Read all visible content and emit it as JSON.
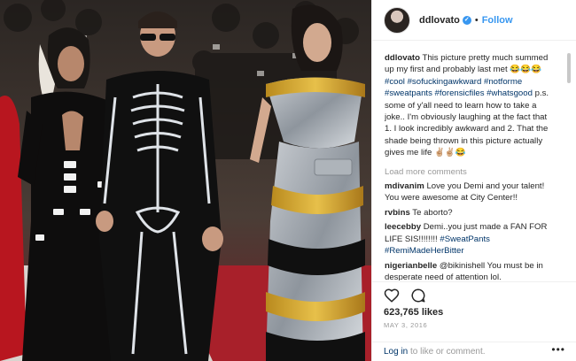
{
  "header": {
    "username": "ddlovato",
    "verified_mark": "✓",
    "separator": "•",
    "follow_label": "Follow"
  },
  "caption": {
    "username": "ddlovato",
    "text1": "This picture pretty much summed up my first and probably last met 😂😂😂",
    "tags1": "#cool #sofuckingawkward #notforme #sweatpants #forensicfiles #whatsgood",
    "text2": "p.s. some of y'all need to learn how to take a joke.. I'm obviously laughing at the fact that 1. I look incredibly awkward and 2. That the shade being thrown in this picture actually gives me life ✌🏼✌🏼😂"
  },
  "load_more": "Load more comments",
  "comments": [
    {
      "user": "mdivanim",
      "text": "Love you Demi and your talent! You were awesome at City Center!!",
      "tags": ""
    },
    {
      "user": "rvbins",
      "text": "Te aborto?",
      "tags": ""
    },
    {
      "user": "leecebby",
      "text": "Demi..you just made a FAN FOR LIFE SIS!!!!!!!!",
      "tags": "#SweatPants #RemiMadeHerBitter"
    },
    {
      "user": "nigerianbelle",
      "text": "@bikinishell You must be in desperate need of attention lol.",
      "tags": ""
    }
  ],
  "likes": "623,765 likes",
  "date": "MAY 3, 2016",
  "login": {
    "link": "Log in",
    "text": " to like or comment."
  },
  "more_label": "•••",
  "icons": {
    "like": "heart-icon",
    "comment": "comment-icon",
    "more": "more-options-icon"
  },
  "colors": {
    "link": "#003569",
    "accent": "#3897f0",
    "muted": "#999999"
  }
}
